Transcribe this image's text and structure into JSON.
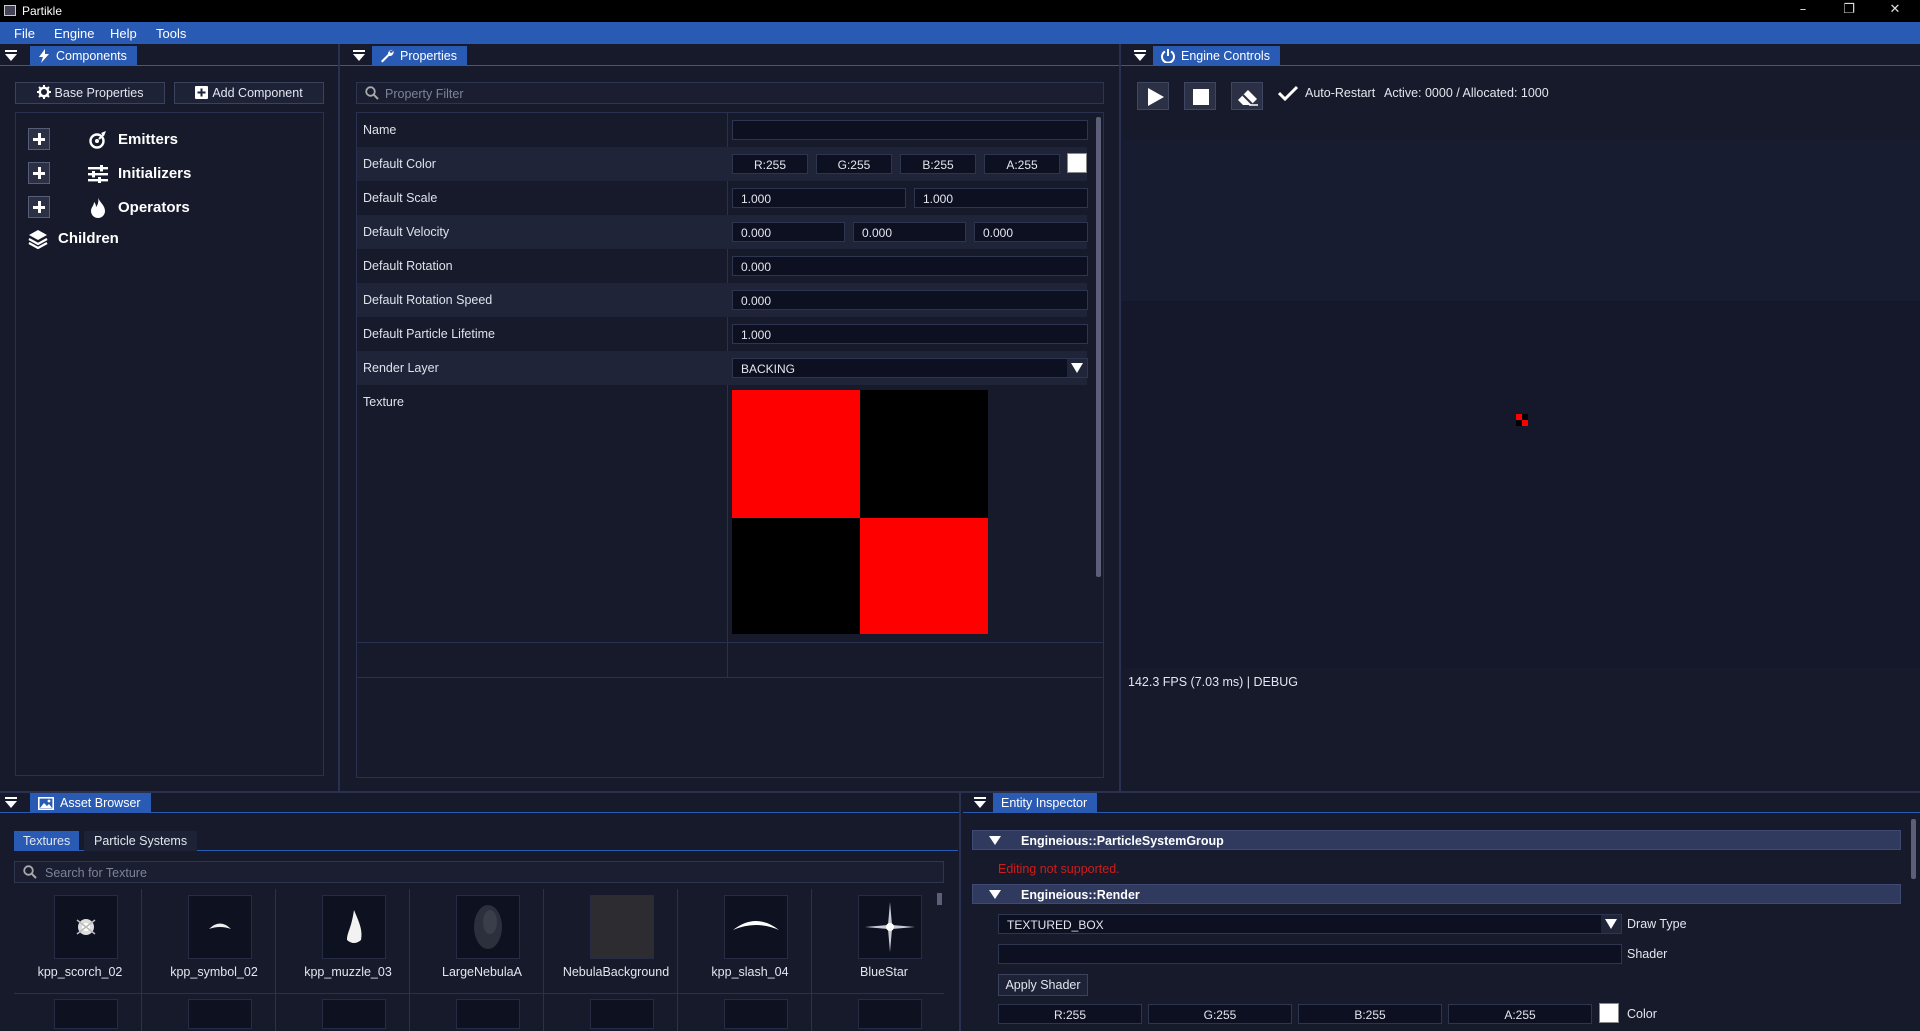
{
  "window": {
    "title": "Partikle"
  },
  "menu": {
    "file": "File",
    "engine": "Engine",
    "help": "Help",
    "tools": "Tools"
  },
  "components": {
    "tab": "Components",
    "base_properties_btn": "Base Properties",
    "add_component_btn": "Add Component",
    "tree": {
      "emitters": "Emitters",
      "initializers": "Initializers",
      "operators": "Operators",
      "children": "Children"
    }
  },
  "properties": {
    "tab": "Properties",
    "filter_placeholder": "Property Filter",
    "rows": {
      "name": {
        "label": "Name",
        "value": ""
      },
      "default_color": {
        "label": "Default Color",
        "r": "R:255",
        "g": "G:255",
        "b": "B:255",
        "a": "A:255",
        "swatch": "#ffffff"
      },
      "default_scale": {
        "label": "Default Scale",
        "x": "1.000",
        "y": "1.000"
      },
      "default_velocity": {
        "label": "Default Velocity",
        "x": "0.000",
        "y": "0.000",
        "z": "0.000"
      },
      "default_rotation": {
        "label": "Default Rotation",
        "value": "0.000"
      },
      "default_rotation_speed": {
        "label": "Default Rotation Speed",
        "value": "0.000"
      },
      "default_particle_lifetime": {
        "label": "Default Particle Lifetime",
        "value": "1.000"
      },
      "render_layer": {
        "label": "Render Layer",
        "value": "BACKING"
      },
      "texture": {
        "label": "Texture",
        "colors": [
          "#ff0000",
          "#000000",
          "#000000",
          "#ff0000"
        ]
      }
    }
  },
  "engine_controls": {
    "tab": "Engine Controls",
    "auto_restart": "Auto-Restart",
    "active_status": "Active: 0000 / Allocated: 1000",
    "fps": "142.3 FPS (7.03 ms) | DEBUG"
  },
  "asset_browser": {
    "tab": "Asset Browser",
    "subtabs": {
      "textures": "Textures",
      "particle_systems": "Particle Systems"
    },
    "search_placeholder": "Search for Texture",
    "assets": [
      "kpp_scorch_02",
      "kpp_symbol_02",
      "kpp_muzzle_03",
      "LargeNebulaA",
      "NebulaBackground",
      "kpp_slash_04",
      "BlueStar"
    ]
  },
  "entity_inspector": {
    "tab": "Entity Inspector",
    "group1": {
      "title": "Engineious::ParticleSystemGroup",
      "message": "Editing not supported."
    },
    "group2": {
      "title": "Engineious::Render",
      "draw_type_value": "TEXTURED_BOX",
      "draw_type_label": "Draw Type",
      "shader_value": "",
      "shader_label": "Shader",
      "apply_shader": "Apply Shader",
      "color": {
        "r": "R:255",
        "g": "G:255",
        "b": "B:255",
        "a": "A:255",
        "label": "Color",
        "swatch": "#ffffff"
      }
    }
  },
  "colors": {
    "accent": "#2a5bb4",
    "background": "#161a2b",
    "error": "#d01c1c"
  }
}
